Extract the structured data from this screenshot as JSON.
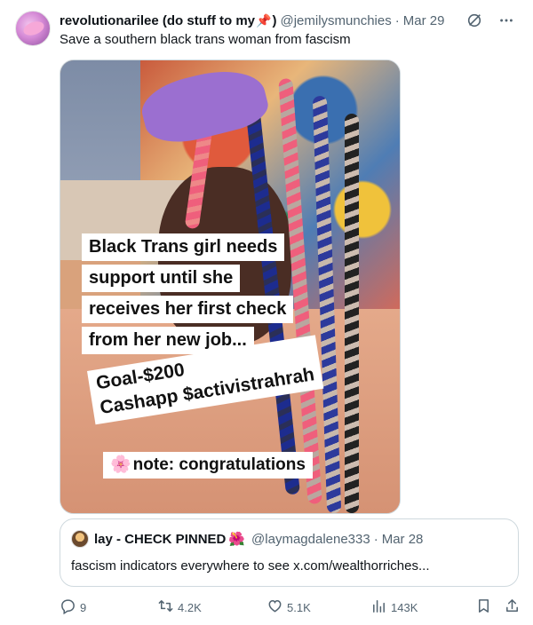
{
  "post": {
    "display_name": "revolutionarilee (do stuff to my",
    "name_emoji": "📌",
    "name_close": ")",
    "handle": "@jemilysmunchies",
    "dot": "·",
    "time": "Mar 29",
    "text": "Save a southern black trans woman from fascism"
  },
  "image_caption": {
    "line1": "Black Trans girl needs",
    "line2": "support until she",
    "line3": "receives her first check",
    "line4": "from her new job...",
    "goal": "Goal-$200",
    "cashapp": "Cashapp $activistrahrah",
    "note_emoji": "🌸",
    "note": "note: congratulations"
  },
  "quoted_post": {
    "display_name": "lay - CHECK PINNED",
    "name_emoji": "🌺",
    "handle": "@laymagdalene333",
    "dot": "·",
    "time": "Mar 28",
    "text": "fascism indicators everywhere to see x.com/wealthorriches..."
  },
  "actions": {
    "replies": "9",
    "reposts": "4.2K",
    "likes": "5.1K",
    "views": "143K"
  },
  "icons": {
    "header": [
      "grok-icon",
      "more-icon"
    ],
    "bar": [
      "reply-icon",
      "repost-icon",
      "like-icon",
      "views-icon",
      "bookmark-icon",
      "share-icon"
    ]
  },
  "colors": {
    "text_primary": "#0f1419",
    "text_secondary": "#536471",
    "border": "#cfd9de"
  }
}
